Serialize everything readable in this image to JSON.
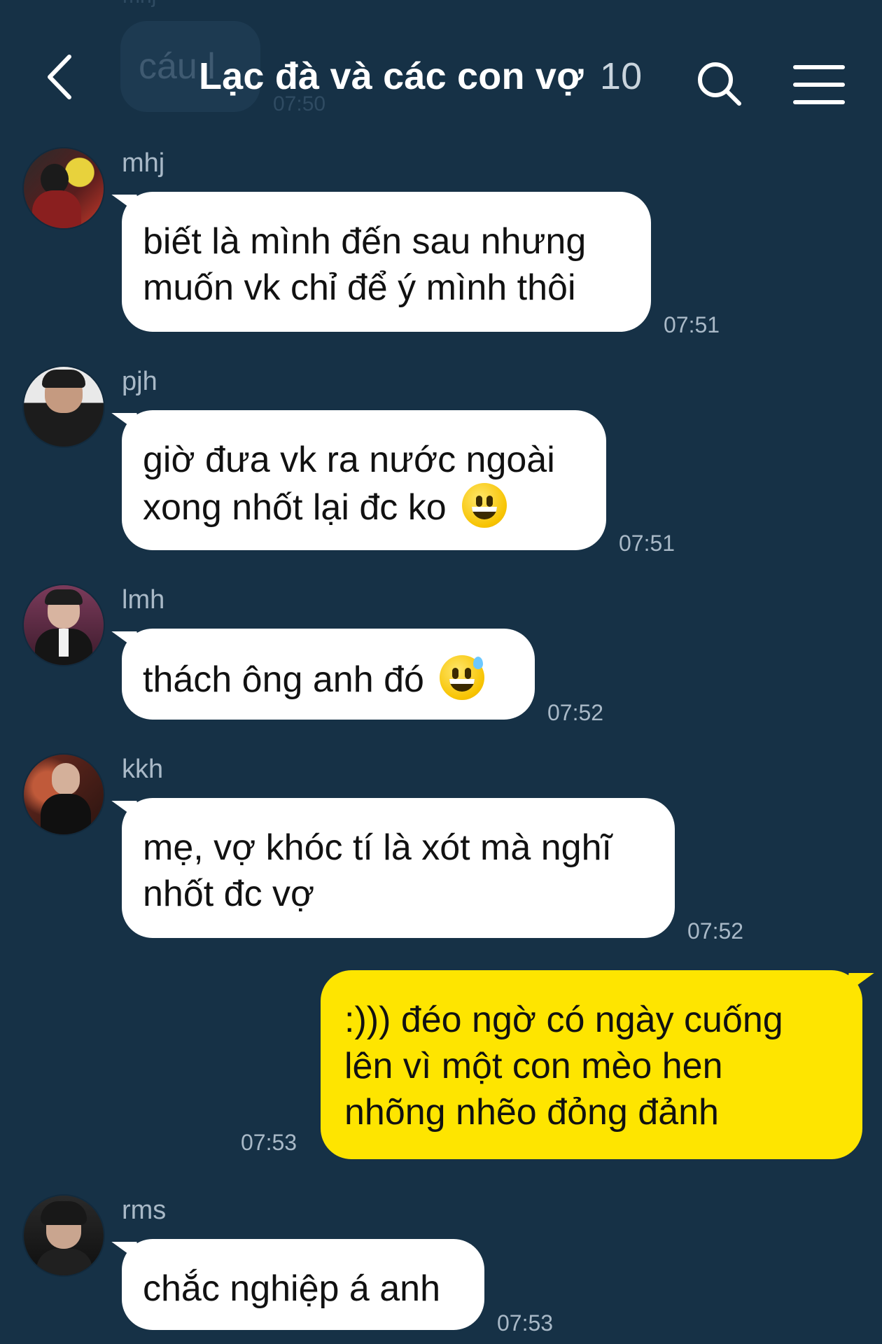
{
  "header": {
    "title": "Lạc đà và các con vợ",
    "member_count": "10",
    "back_icon": "chevron-left-icon",
    "search_icon": "search-icon",
    "menu_icon": "hamburger-menu-icon"
  },
  "partial_previous": {
    "sender": "mhj",
    "text": "cáu l",
    "time": "07:50"
  },
  "messages": [
    {
      "sender": "mhj",
      "lines": [
        "biết là mình đến sau nhưng",
        "muốn vk chỉ để ý mình thôi"
      ],
      "time": "07:51",
      "emoji": ""
    },
    {
      "sender": "pjh",
      "lines": [
        "giờ đưa vk ra nước ngoài",
        "xong nhốt lại đc ko"
      ],
      "time": "07:51",
      "emoji": "smiley-emoji"
    },
    {
      "sender": "lmh",
      "lines": [
        "thách ông anh đó"
      ],
      "time": "07:52",
      "emoji": "grin-sweat-emoji"
    },
    {
      "sender": "kkh",
      "lines": [
        "mẹ, vợ khóc tí là xót mà nghĩ",
        "nhốt đc vợ"
      ],
      "time": "07:52",
      "emoji": ""
    },
    {
      "sender": "me",
      "lines": [
        ":))) đéo ngờ có ngày cuống",
        "lên vì một con mèo hen",
        "nhõng nhẽo đỏng đảnh"
      ],
      "time": "07:53",
      "emoji": ""
    },
    {
      "sender": "rms",
      "lines": [
        "chắc nghiệp á anh"
      ],
      "time": "07:53",
      "emoji": ""
    }
  ],
  "colors": {
    "background": "#163146",
    "bubble_other": "#ffffff",
    "bubble_self": "#fee500",
    "meta_text": "#a9b9c7"
  }
}
